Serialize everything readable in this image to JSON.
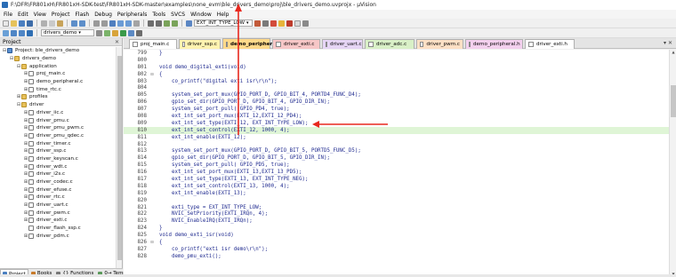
{
  "window": {
    "title": "F:\\DFR\\FR801xH\\FR801xH-SDK-test\\FR801xH-SDK-master\\examples\\none_evm\\ble_drivers_demo\\proj\\ble_drivers_demo.uvprojx - µVision"
  },
  "menu": [
    "File",
    "Edit",
    "View",
    "Project",
    "Flash",
    "Debug",
    "Peripherals",
    "Tools",
    "SVCS",
    "Window",
    "Help"
  ],
  "toolbar1": {
    "search_value": "EXT_INT_TYPE_LOW"
  },
  "toolbar2": {
    "target_value": "drivers_demo"
  },
  "project_panel": {
    "title": "Project",
    "close_glyph": "✕",
    "tree": [
      {
        "label": "Project: ble_drivers_demo",
        "kind": "project",
        "exp": "⊟"
      },
      {
        "label": "drivers_demo",
        "kind": "folder",
        "exp": "⊟"
      },
      {
        "label": "application",
        "kind": "folder",
        "exp": "⊟"
      },
      {
        "label": "proj_main.c",
        "kind": "file",
        "exp": "⊞"
      },
      {
        "label": "demo_peripheral.c",
        "kind": "file",
        "exp": "⊞"
      },
      {
        "label": "time_rtc.c",
        "kind": "file",
        "exp": "⊞"
      },
      {
        "label": "profiles",
        "kind": "folder",
        "exp": "⊞"
      },
      {
        "label": "driver",
        "kind": "folder",
        "exp": "⊟"
      },
      {
        "label": "driver_iic.c",
        "kind": "file",
        "exp": "⊞"
      },
      {
        "label": "driver_pmu.c",
        "kind": "file",
        "exp": "⊞"
      },
      {
        "label": "driver_pmu_pwm.c",
        "kind": "file",
        "exp": "⊞"
      },
      {
        "label": "driver_pmu_qdec.c",
        "kind": "file",
        "exp": "⊞"
      },
      {
        "label": "driver_timer.c",
        "kind": "file",
        "exp": "⊞"
      },
      {
        "label": "driver_ssp.c",
        "kind": "file",
        "exp": "⊞"
      },
      {
        "label": "driver_keyscan.c",
        "kind": "file",
        "exp": "⊞"
      },
      {
        "label": "driver_wdt.c",
        "kind": "file",
        "exp": "⊞"
      },
      {
        "label": "driver_i2s.c",
        "kind": "file",
        "exp": "⊞"
      },
      {
        "label": "driver_codec.c",
        "kind": "file",
        "exp": "⊞"
      },
      {
        "label": "driver_efuse.c",
        "kind": "file",
        "exp": "⊞"
      },
      {
        "label": "driver_rtc.c",
        "kind": "file",
        "exp": "⊞"
      },
      {
        "label": "driver_uart.c",
        "kind": "file",
        "exp": "⊞"
      },
      {
        "label": "driver_pwm.c",
        "kind": "file",
        "exp": "⊞"
      },
      {
        "label": "driver_exti.c",
        "kind": "file",
        "exp": "⊞"
      },
      {
        "label": "driver_flash_ssp.c",
        "kind": "file",
        "exp": ""
      },
      {
        "label": "driver_pdm.c",
        "kind": "file",
        "exp": "⊞"
      }
    ],
    "tabs": [
      {
        "label": "Project",
        "color": "#4a7fc0"
      },
      {
        "label": "Books",
        "color": "#c77a2a"
      },
      {
        "label": "{} Functions",
        "color": "#777"
      },
      {
        "label": "0→ Templates",
        "color": "#5a9a5a"
      }
    ]
  },
  "editor_tabs": [
    {
      "label": "proj_main.c",
      "color": "#ffffff",
      "active": false
    },
    {
      "label": "driver_ssp.c",
      "color": "#fff3b0",
      "active": false
    },
    {
      "label": "demo_peripheral.c",
      "color": "#ffd98a",
      "active": true
    },
    {
      "label": "driver_exti.c",
      "color": "#f7c7c7",
      "active": false
    },
    {
      "label": "driver_uart.c",
      "color": "#e6d5f5",
      "active": false
    },
    {
      "label": "driver_adc.c",
      "color": "#d9f0c7",
      "active": false
    },
    {
      "label": "driver_pwm.c",
      "color": "#fde0c5",
      "active": false
    },
    {
      "label": "demo_peripheral.h",
      "color": "#f3d0ee",
      "active": false
    },
    {
      "label": "driver_exti.h",
      "color": "#ffffff",
      "active": false
    }
  ],
  "editor_close_glyph": "▾ ✕",
  "code": [
    {
      "n": "799",
      "fold": "",
      "text": "}"
    },
    {
      "n": "800",
      "fold": "",
      "text": ""
    },
    {
      "n": "801",
      "fold": "",
      "text": "void demo_digital_exti(void)"
    },
    {
      "n": "802",
      "fold": "⊟",
      "text": "{"
    },
    {
      "n": "803",
      "fold": "",
      "text": "    co_printf(\"digital exti isr\\r\\n\");"
    },
    {
      "n": "804",
      "fold": "",
      "text": ""
    },
    {
      "n": "805",
      "fold": "",
      "text": "    system_set_port_mux(GPIO_PORT_D, GPIO_BIT_4, PORTD4_FUNC_D4);"
    },
    {
      "n": "806",
      "fold": "",
      "text": "    gpio_set_dir(GPIO_PORT_D, GPIO_BIT_4, GPIO_DIR_IN);"
    },
    {
      "n": "807",
      "fold": "",
      "text": "    system_set_port_pull( GPIO_PD4, true);"
    },
    {
      "n": "808",
      "fold": "",
      "text": "    ext_int_set_port_mux(EXTI_12,EXTI_12_PD4);"
    },
    {
      "n": "809",
      "fold": "",
      "text": "    ext_int_set_type(EXTI_12, EXT_INT_TYPE_LOW);"
    },
    {
      "n": "810",
      "fold": "",
      "text": "    ext_int_set_control(EXTI_12, 1000, 4);",
      "hl": true
    },
    {
      "n": "811",
      "fold": "",
      "text": "    ext_int_enable(EXTI_12);"
    },
    {
      "n": "812",
      "fold": "",
      "text": ""
    },
    {
      "n": "813",
      "fold": "",
      "text": "    system_set_port_mux(GPIO_PORT_D, GPIO_BIT_5, PORTD5_FUNC_D5);"
    },
    {
      "n": "814",
      "fold": "",
      "text": "    gpio_set_dir(GPIO_PORT_D, GPIO_BIT_5, GPIO_DIR_IN);"
    },
    {
      "n": "815",
      "fold": "",
      "text": "    system_set_port_pull( GPIO_PD5, true);"
    },
    {
      "n": "816",
      "fold": "",
      "text": "    ext_int_set_port_mux(EXTI_13,EXTI_13_PD5);"
    },
    {
      "n": "817",
      "fold": "",
      "text": "    ext_int_set_type(EXTI_13, EXT_INT_TYPE_NEG);"
    },
    {
      "n": "818",
      "fold": "",
      "text": "    ext_int_set_control(EXTI_13, 1000, 4);"
    },
    {
      "n": "819",
      "fold": "",
      "text": "    ext_int_enable(EXTI_13);"
    },
    {
      "n": "820",
      "fold": "",
      "text": ""
    },
    {
      "n": "821",
      "fold": "",
      "text": "    exti_type = EXT_INT_TYPE_LOW;"
    },
    {
      "n": "822",
      "fold": "",
      "text": "    NVIC_SetPriority(EXTI_IRQn, 4);"
    },
    {
      "n": "823",
      "fold": "",
      "text": "    NVIC_EnableIRQ(EXTI_IRQn);"
    },
    {
      "n": "824",
      "fold": "",
      "text": "}"
    },
    {
      "n": "825",
      "fold": "",
      "text": "void demo_exti_isr(void)"
    },
    {
      "n": "826",
      "fold": "⊟",
      "text": "{"
    },
    {
      "n": "827",
      "fold": "",
      "text": "    co_printf(\"exti isr demo\\r\\n\");"
    },
    {
      "n": "828",
      "fold": "",
      "text": "    demo_pmu_exti();"
    }
  ],
  "annotation_color": "#e8281e"
}
